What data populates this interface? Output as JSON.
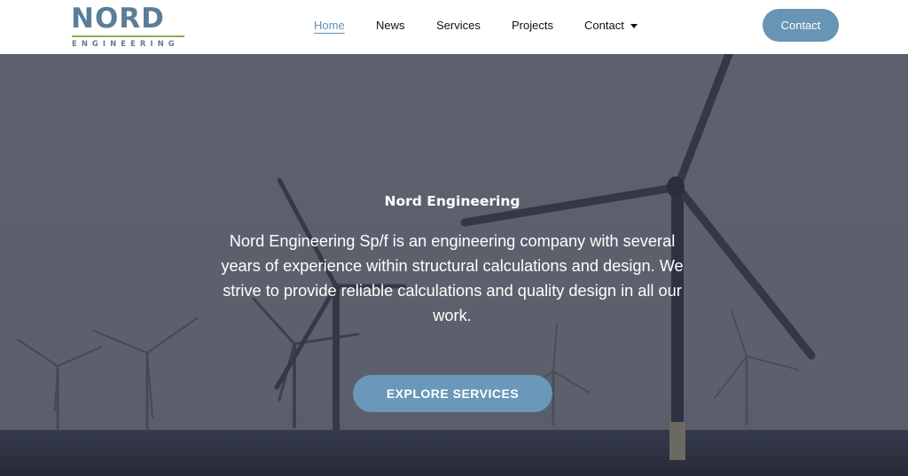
{
  "logo": {
    "word": "NORD",
    "sub": "ENGINEERING"
  },
  "nav": {
    "items": [
      {
        "label": "Home",
        "active": true
      },
      {
        "label": "News"
      },
      {
        "label": "Services"
      },
      {
        "label": "Projects"
      },
      {
        "label": "Contact",
        "has_dropdown": true
      }
    ]
  },
  "header_button": {
    "label": "Contact"
  },
  "hero": {
    "title": "Nord Engineering",
    "description": "Nord Engineering Sp/f is an engineering company with several years of experience within structural calculations and design. We strive to provide reliable calculations and quality design in all our work.",
    "button_label": "EXPLORE SERVICES"
  },
  "colors": {
    "accent": "#6895b3",
    "logo_blue": "#5a7e98",
    "logo_green": "#8ab04a",
    "overlay": "#5b5f6c",
    "sea": "#2f3446"
  },
  "icons": {
    "dropdown": "caret-down-icon"
  }
}
